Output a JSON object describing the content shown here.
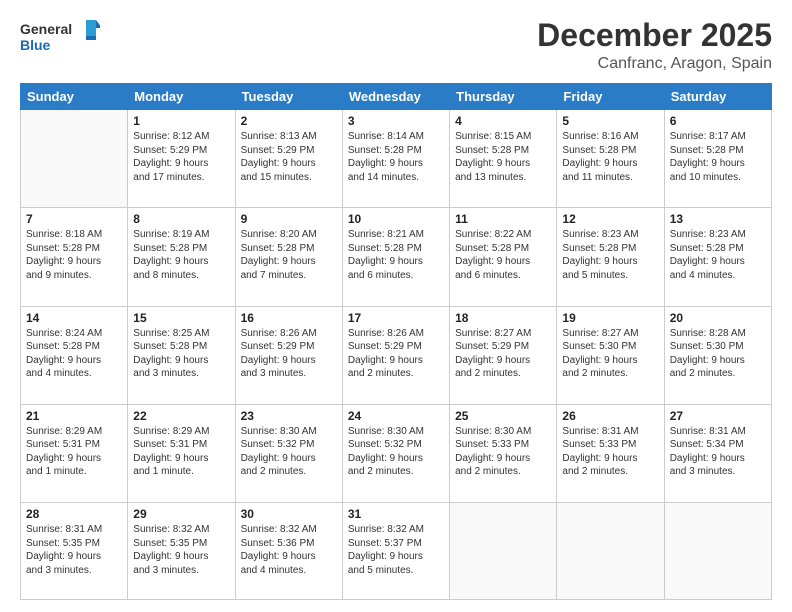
{
  "logo": {
    "line1": "General",
    "line2": "Blue"
  },
  "title": "December 2025",
  "location": "Canfranc, Aragon, Spain",
  "days_of_week": [
    "Sunday",
    "Monday",
    "Tuesday",
    "Wednesday",
    "Thursday",
    "Friday",
    "Saturday"
  ],
  "weeks": [
    [
      {
        "day": "",
        "info": ""
      },
      {
        "day": "1",
        "info": "Sunrise: 8:12 AM\nSunset: 5:29 PM\nDaylight: 9 hours\nand 17 minutes."
      },
      {
        "day": "2",
        "info": "Sunrise: 8:13 AM\nSunset: 5:29 PM\nDaylight: 9 hours\nand 15 minutes."
      },
      {
        "day": "3",
        "info": "Sunrise: 8:14 AM\nSunset: 5:28 PM\nDaylight: 9 hours\nand 14 minutes."
      },
      {
        "day": "4",
        "info": "Sunrise: 8:15 AM\nSunset: 5:28 PM\nDaylight: 9 hours\nand 13 minutes."
      },
      {
        "day": "5",
        "info": "Sunrise: 8:16 AM\nSunset: 5:28 PM\nDaylight: 9 hours\nand 11 minutes."
      },
      {
        "day": "6",
        "info": "Sunrise: 8:17 AM\nSunset: 5:28 PM\nDaylight: 9 hours\nand 10 minutes."
      }
    ],
    [
      {
        "day": "7",
        "info": "Sunrise: 8:18 AM\nSunset: 5:28 PM\nDaylight: 9 hours\nand 9 minutes."
      },
      {
        "day": "8",
        "info": "Sunrise: 8:19 AM\nSunset: 5:28 PM\nDaylight: 9 hours\nand 8 minutes."
      },
      {
        "day": "9",
        "info": "Sunrise: 8:20 AM\nSunset: 5:28 PM\nDaylight: 9 hours\nand 7 minutes."
      },
      {
        "day": "10",
        "info": "Sunrise: 8:21 AM\nSunset: 5:28 PM\nDaylight: 9 hours\nand 6 minutes."
      },
      {
        "day": "11",
        "info": "Sunrise: 8:22 AM\nSunset: 5:28 PM\nDaylight: 9 hours\nand 6 minutes."
      },
      {
        "day": "12",
        "info": "Sunrise: 8:23 AM\nSunset: 5:28 PM\nDaylight: 9 hours\nand 5 minutes."
      },
      {
        "day": "13",
        "info": "Sunrise: 8:23 AM\nSunset: 5:28 PM\nDaylight: 9 hours\nand 4 minutes."
      }
    ],
    [
      {
        "day": "14",
        "info": "Sunrise: 8:24 AM\nSunset: 5:28 PM\nDaylight: 9 hours\nand 4 minutes."
      },
      {
        "day": "15",
        "info": "Sunrise: 8:25 AM\nSunset: 5:28 PM\nDaylight: 9 hours\nand 3 minutes."
      },
      {
        "day": "16",
        "info": "Sunrise: 8:26 AM\nSunset: 5:29 PM\nDaylight: 9 hours\nand 3 minutes."
      },
      {
        "day": "17",
        "info": "Sunrise: 8:26 AM\nSunset: 5:29 PM\nDaylight: 9 hours\nand 2 minutes."
      },
      {
        "day": "18",
        "info": "Sunrise: 8:27 AM\nSunset: 5:29 PM\nDaylight: 9 hours\nand 2 minutes."
      },
      {
        "day": "19",
        "info": "Sunrise: 8:27 AM\nSunset: 5:30 PM\nDaylight: 9 hours\nand 2 minutes."
      },
      {
        "day": "20",
        "info": "Sunrise: 8:28 AM\nSunset: 5:30 PM\nDaylight: 9 hours\nand 2 minutes."
      }
    ],
    [
      {
        "day": "21",
        "info": "Sunrise: 8:29 AM\nSunset: 5:31 PM\nDaylight: 9 hours\nand 1 minute."
      },
      {
        "day": "22",
        "info": "Sunrise: 8:29 AM\nSunset: 5:31 PM\nDaylight: 9 hours\nand 1 minute."
      },
      {
        "day": "23",
        "info": "Sunrise: 8:30 AM\nSunset: 5:32 PM\nDaylight: 9 hours\nand 2 minutes."
      },
      {
        "day": "24",
        "info": "Sunrise: 8:30 AM\nSunset: 5:32 PM\nDaylight: 9 hours\nand 2 minutes."
      },
      {
        "day": "25",
        "info": "Sunrise: 8:30 AM\nSunset: 5:33 PM\nDaylight: 9 hours\nand 2 minutes."
      },
      {
        "day": "26",
        "info": "Sunrise: 8:31 AM\nSunset: 5:33 PM\nDaylight: 9 hours\nand 2 minutes."
      },
      {
        "day": "27",
        "info": "Sunrise: 8:31 AM\nSunset: 5:34 PM\nDaylight: 9 hours\nand 3 minutes."
      }
    ],
    [
      {
        "day": "28",
        "info": "Sunrise: 8:31 AM\nSunset: 5:35 PM\nDaylight: 9 hours\nand 3 minutes."
      },
      {
        "day": "29",
        "info": "Sunrise: 8:32 AM\nSunset: 5:35 PM\nDaylight: 9 hours\nand 3 minutes."
      },
      {
        "day": "30",
        "info": "Sunrise: 8:32 AM\nSunset: 5:36 PM\nDaylight: 9 hours\nand 4 minutes."
      },
      {
        "day": "31",
        "info": "Sunrise: 8:32 AM\nSunset: 5:37 PM\nDaylight: 9 hours\nand 5 minutes."
      },
      {
        "day": "",
        "info": ""
      },
      {
        "day": "",
        "info": ""
      },
      {
        "day": "",
        "info": ""
      }
    ]
  ]
}
